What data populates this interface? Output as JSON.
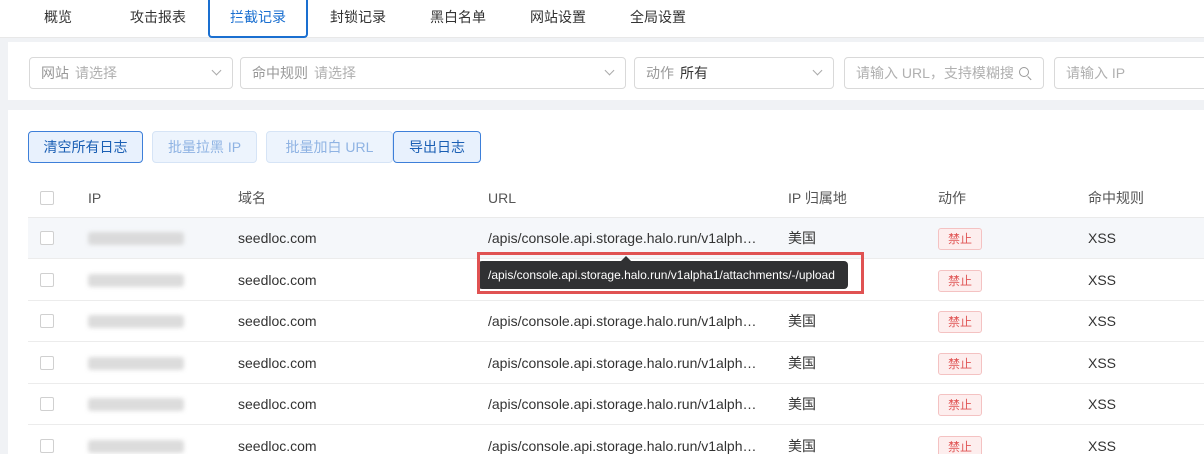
{
  "tabs": [
    "概览",
    "攻击报表",
    "拦截记录",
    "封锁记录",
    "黑白名单",
    "网站设置",
    "全局设置"
  ],
  "active_tab": "拦截记录",
  "filters": {
    "site": {
      "label": "网站",
      "placeholder": "请选择"
    },
    "rule": {
      "label": "命中规则",
      "placeholder": "请选择"
    },
    "action": {
      "label": "动作",
      "value": "所有"
    },
    "url_search": {
      "placeholder": "请输入 URL，支持模糊搜"
    },
    "ip_search": {
      "placeholder": "请输入 IP"
    }
  },
  "toolbar": {
    "clear_all": "清空所有日志",
    "batch_block_ip": "批量拉黑 IP",
    "batch_allow_url": "批量加白 URL",
    "export": "导出日志"
  },
  "table": {
    "columns": [
      "IP",
      "域名",
      "URL",
      "IP 归属地",
      "动作",
      "命中规则"
    ],
    "rows": [
      {
        "domain": "seedloc.com",
        "url": "/apis/console.api.storage.halo.run/v1alph…",
        "location": "美国",
        "action": "禁止",
        "rule": "XSS"
      },
      {
        "domain": "seedloc.com",
        "url": "",
        "location": "",
        "action": "禁止",
        "rule": "XSS"
      },
      {
        "domain": "seedloc.com",
        "url": "/apis/console.api.storage.halo.run/v1alph…",
        "location": "美国",
        "action": "禁止",
        "rule": "XSS"
      },
      {
        "domain": "seedloc.com",
        "url": "/apis/console.api.storage.halo.run/v1alph…",
        "location": "美国",
        "action": "禁止",
        "rule": "XSS"
      },
      {
        "domain": "seedloc.com",
        "url": "/apis/console.api.storage.halo.run/v1alph…",
        "location": "美国",
        "action": "禁止",
        "rule": "XSS"
      },
      {
        "domain": "seedloc.com",
        "url": "/apis/console.api.storage.halo.run/v1alph…",
        "location": "美国",
        "action": "禁止",
        "rule": "XSS"
      }
    ]
  },
  "tooltip": {
    "text": "/apis/console.api.storage.halo.run/v1alpha1/attachments/-/upload"
  },
  "colors": {
    "accent": "#1a6fd0",
    "danger": "#e05555",
    "highlight": "#e05252"
  }
}
